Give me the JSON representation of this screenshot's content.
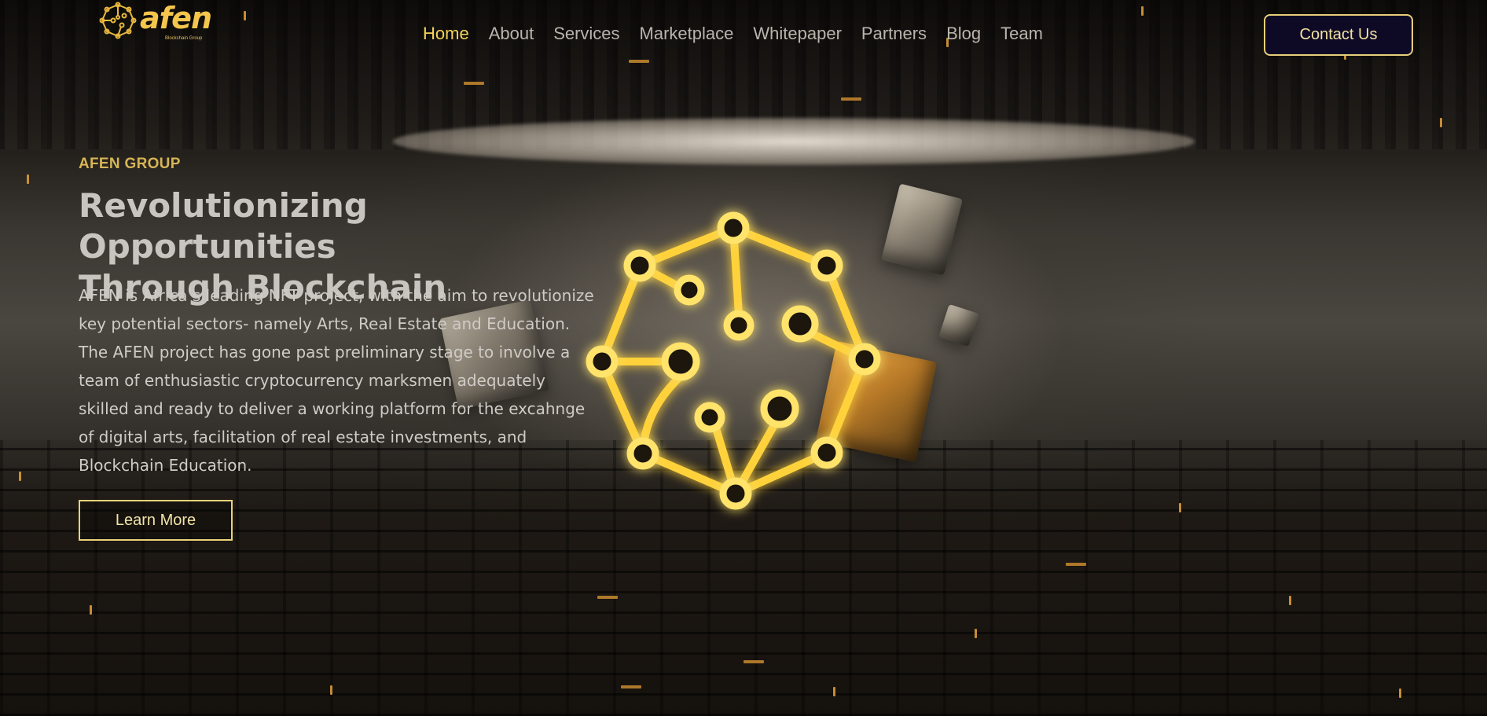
{
  "brand": {
    "name": "afen",
    "tagline": "Blockchain Group",
    "colors": {
      "gold": "#f4c64c",
      "navy": "#0e0a26",
      "text": "#cfcbc6"
    },
    "icon": "afen-logo-icon"
  },
  "nav": {
    "items": [
      {
        "label": "Home",
        "active": true
      },
      {
        "label": "About"
      },
      {
        "label": "Services"
      },
      {
        "label": "Marketplace"
      },
      {
        "label": "Whitepaper"
      },
      {
        "label": "Partners"
      },
      {
        "label": "Blog"
      },
      {
        "label": "Team"
      }
    ],
    "contact_label": "Contact Us"
  },
  "hero": {
    "eyebrow": "AFEN GROUP",
    "title_line1": "Revolutionizing Opportunities",
    "title_line2": "Through Blockchain",
    "description": "AFEN is Africa’s leading NFT project, with the aim to revolutionize key potential sectors- namely Arts, Real Estate and Education. The AFEN project has gone past preliminary stage to involve a team of enthusiastic cryptocurrency marksmen adequately skilled and ready to deliver a working platform for the excahnge of digital arts, facilitation of real estate investments, and Blockchain Education.",
    "cta_label": "Learn More",
    "emblem_icon": "afen-network-emblem-icon"
  }
}
